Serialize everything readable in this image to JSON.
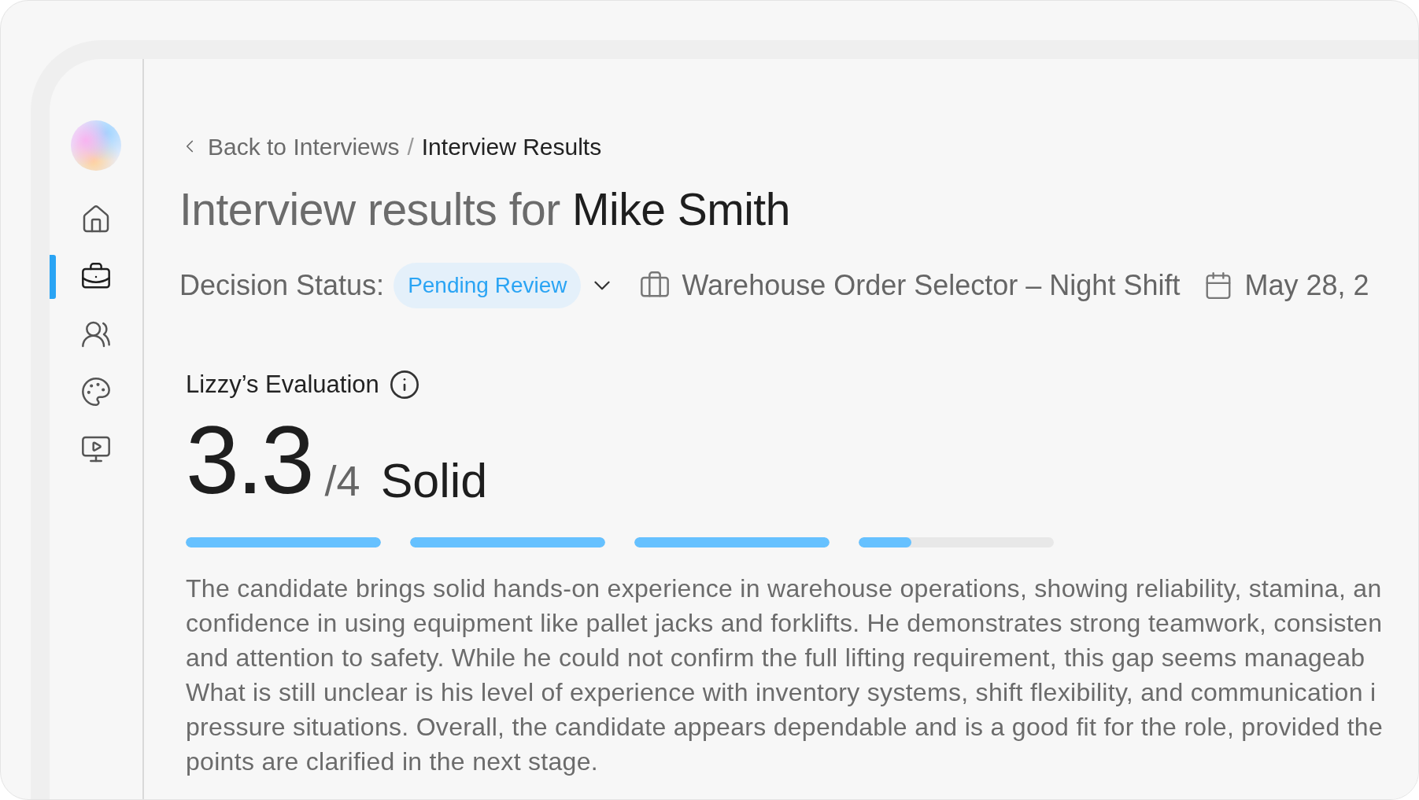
{
  "sidebar": {
    "items": [
      {
        "kind": "home",
        "selected": false
      },
      {
        "kind": "jobs",
        "selected": true
      },
      {
        "kind": "people",
        "selected": false
      },
      {
        "kind": "palette",
        "selected": false
      },
      {
        "kind": "video",
        "selected": false
      }
    ]
  },
  "breadcrumb": {
    "back": "Back to Interviews",
    "separator": "/",
    "current": "Interview Results"
  },
  "title": {
    "prefix": "Interview results for",
    "name": "Mike Smith"
  },
  "decision": {
    "label": "Decision Status:",
    "status": "Pending Review",
    "job": "Warehouse Order Selector – Night Shift",
    "date": "May 28, 2"
  },
  "evaluation": {
    "title": "Lizzy’s Evaluation",
    "score": "3.3",
    "max": "/4",
    "rating": "Solid",
    "segments": [
      {
        "level": 1
      },
      {
        "level": 1
      },
      {
        "level": 1
      },
      {
        "level": 0.27
      }
    ],
    "summary_lines": [
      "The candidate brings solid hands-on experience in warehouse operations, showing reliability, stamina, an",
      "confidence in using equipment like pallet jacks and forklifts. He demonstrates strong teamwork, consisten",
      "and attention to safety. While he could not confirm the full lifting requirement, this gap seems manageab",
      "What is still unclear is his level of experience with inventory systems, shift flexibility, and communication i",
      "pressure situations. Overall, the candidate appears dependable and is a good fit for the role, provided the",
      "points are clarified in the next stage."
    ]
  }
}
